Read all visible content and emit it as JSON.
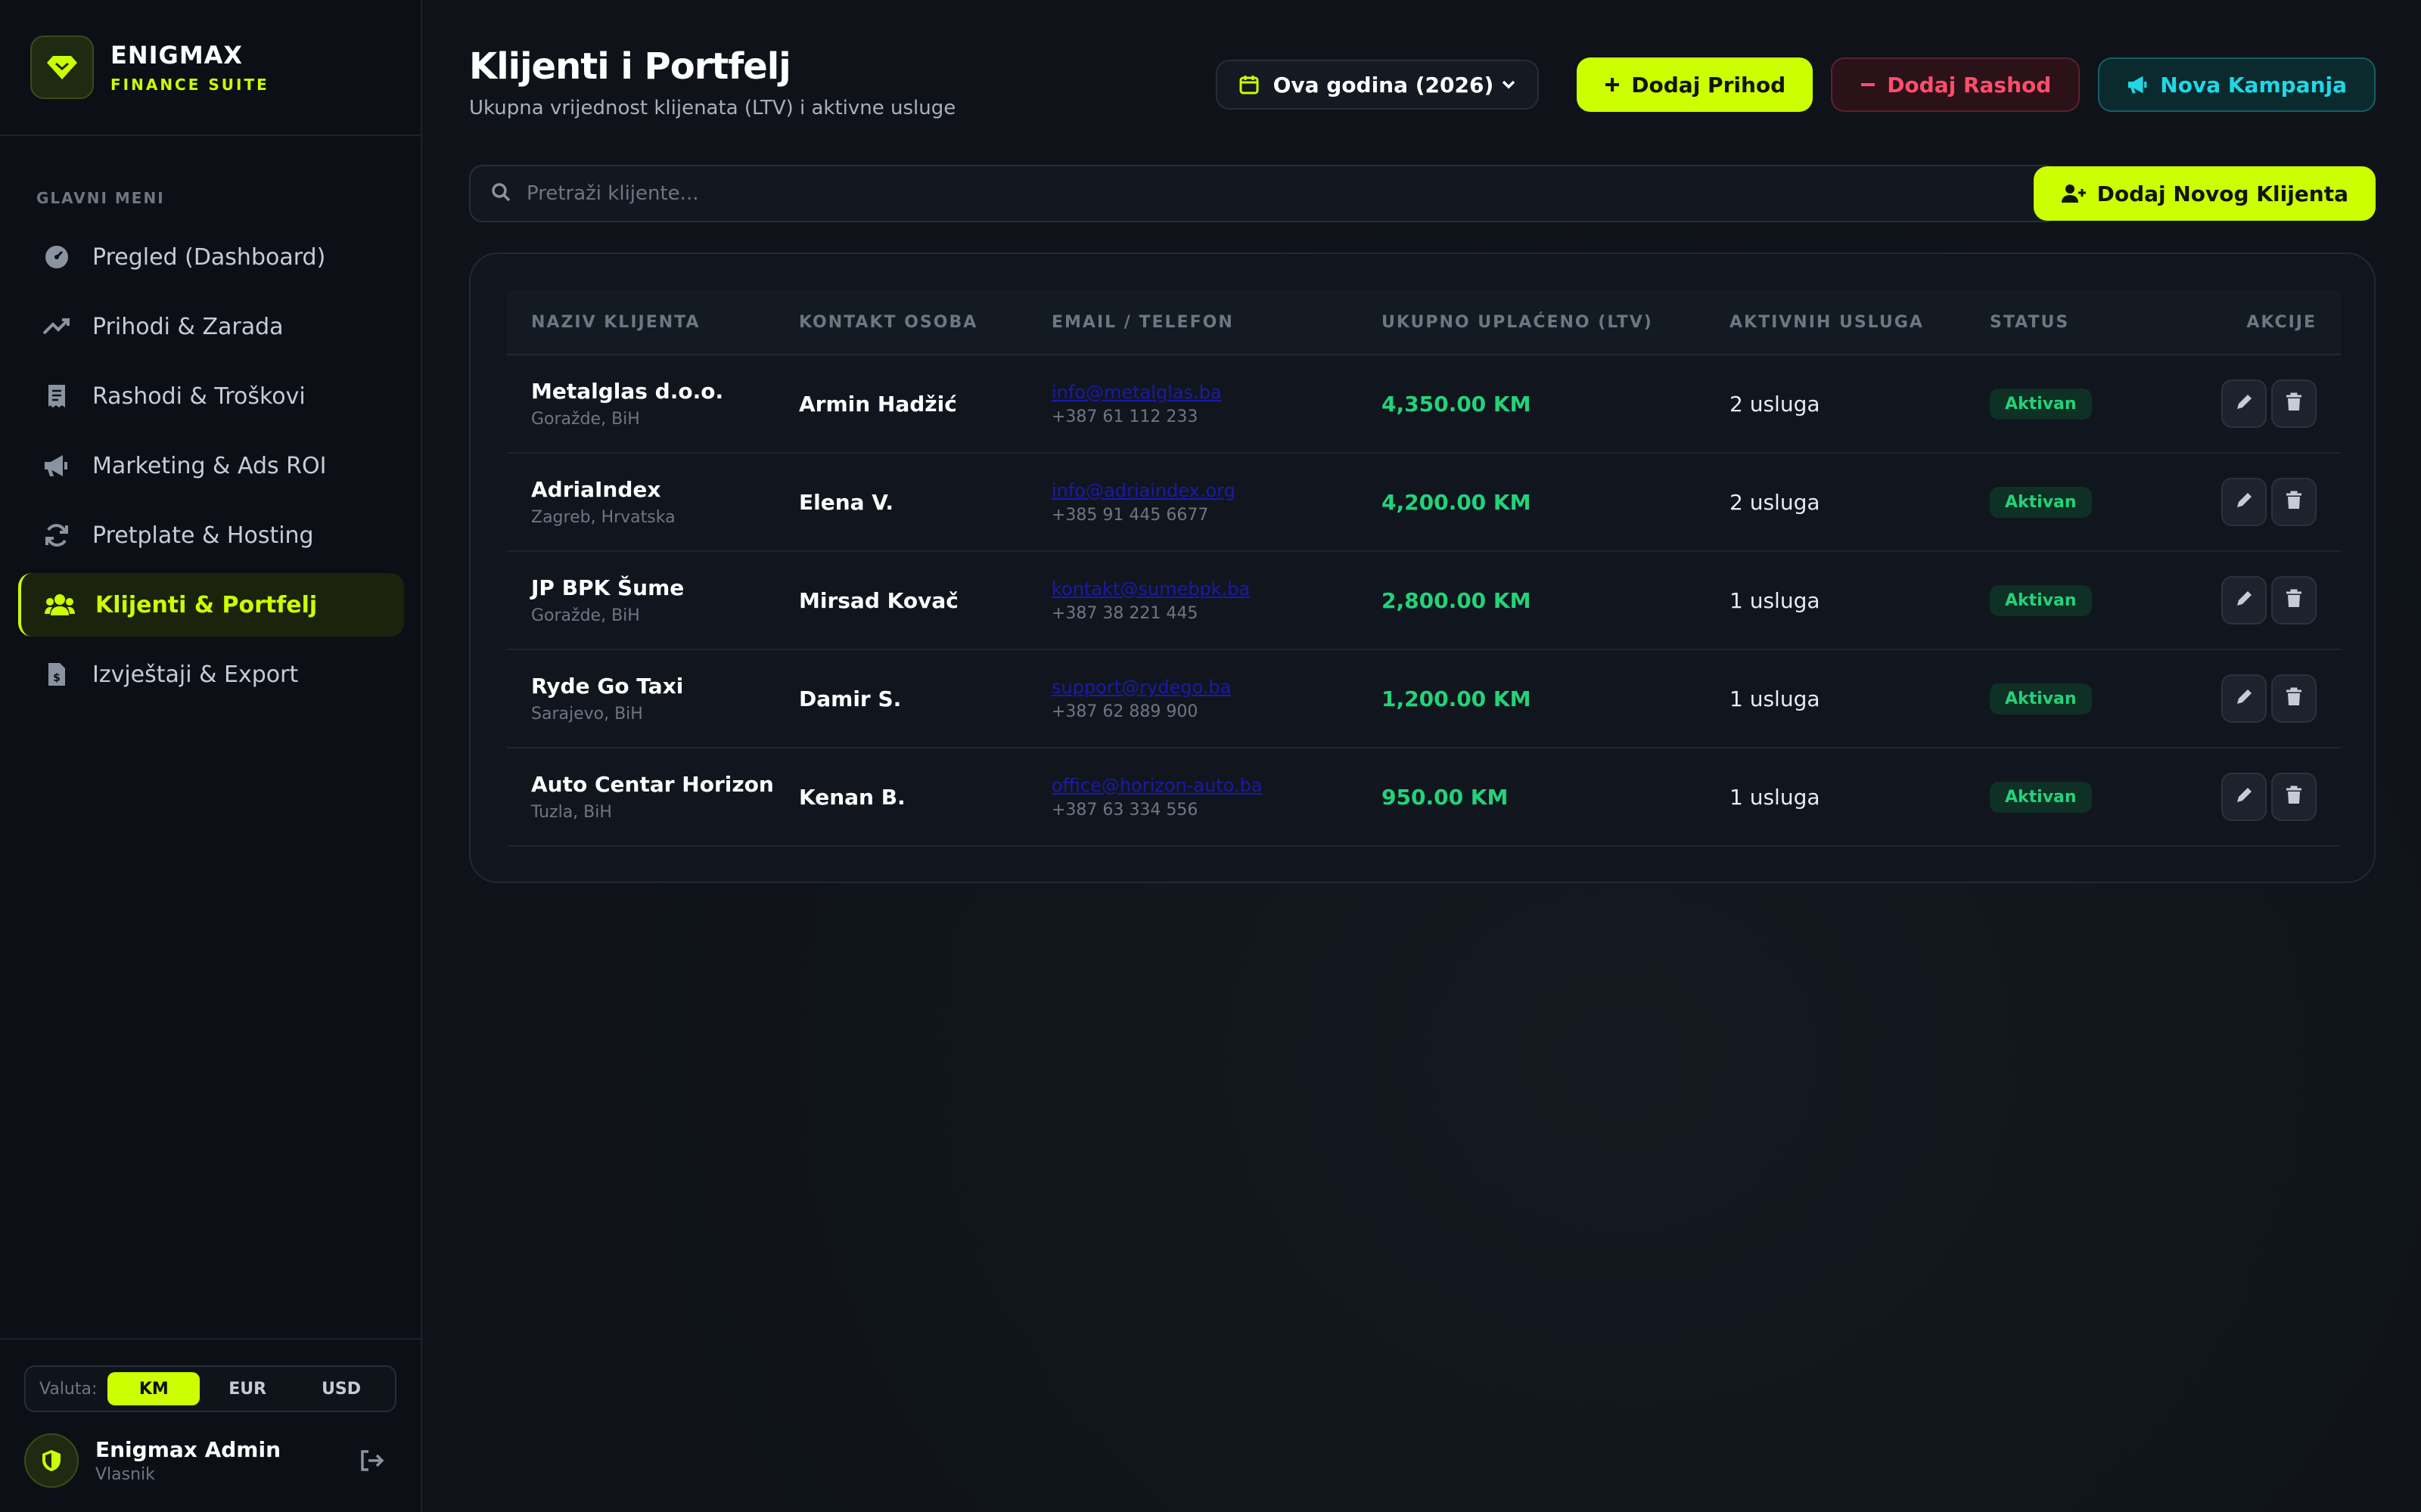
{
  "brand": {
    "name": "ENIGMAX",
    "subtitle": "FINANCE SUITE"
  },
  "menu_heading": "GLAVNI MENI",
  "nav": [
    {
      "label": "Pregled (Dashboard)",
      "icon": "dashboard-gauge-icon"
    },
    {
      "label": "Prihodi & Zarada",
      "icon": "trend-up-icon"
    },
    {
      "label": "Rashodi & Troškovi",
      "icon": "receipt-icon"
    },
    {
      "label": "Marketing & Ads ROI",
      "icon": "megaphone-icon"
    },
    {
      "label": "Pretplate & Hosting",
      "icon": "sync-icon"
    },
    {
      "label": "Klijenti & Portfelj",
      "icon": "users-icon",
      "active": true
    },
    {
      "label": "Izvještaji & Export",
      "icon": "file-invoice-dollar-icon"
    }
  ],
  "currency": {
    "label": "Valuta:",
    "options": [
      "KM",
      "EUR",
      "USD"
    ],
    "selected": "KM"
  },
  "user": {
    "name": "Enigmax Admin",
    "role": "Vlasnik"
  },
  "page": {
    "title": "Klijenti i Portfelj",
    "subtitle": "Ukupna vrijednost klijenata (LTV) i aktivne usluge"
  },
  "toolbar": {
    "period": "Ova godina (2026)",
    "add_income": "Dodaj Prihod",
    "add_expense": "Dodaj Rashod",
    "new_campaign": "Nova Kampanja"
  },
  "search": {
    "placeholder": "Pretraži klijente..."
  },
  "add_client_label": "Dodaj Novog Klijenta",
  "table": {
    "headers": [
      "NAZIV KLIJENTA",
      "KONTAKT OSOBA",
      "EMAIL / TELEFON",
      "UKUPNO UPLAĆENO (LTV)",
      "AKTIVNIH USLUGA",
      "STATUS",
      "AKCIJE"
    ],
    "rows": [
      {
        "name": "Metalglas d.o.o.",
        "location": "Goražde, BiH",
        "contact": "Armin Hadžić",
        "email": "info@metalglas.ba",
        "phone": "+387 61 112 233",
        "ltv": "4,350.00 KM",
        "services": "2 usluga",
        "status": "Aktivan"
      },
      {
        "name": "AdriaIndex",
        "location": "Zagreb, Hrvatska",
        "contact": "Elena V.",
        "email": "info@adriaindex.org",
        "phone": "+385 91 445 6677",
        "ltv": "4,200.00 KM",
        "services": "2 usluga",
        "status": "Aktivan"
      },
      {
        "name": "JP BPK Šume",
        "location": "Goražde, BiH",
        "contact": "Mirsad Kovač",
        "email": "kontakt@sumebpk.ba",
        "phone": "+387 38 221 445",
        "ltv": "2,800.00 KM",
        "services": "1 usluga",
        "status": "Aktivan"
      },
      {
        "name": "Ryde Go Taxi",
        "location": "Sarajevo, BiH",
        "contact": "Damir S.",
        "email": "support@rydego.ba",
        "phone": "+387 62 889 900",
        "ltv": "1,200.00 KM",
        "services": "1 usluga",
        "status": "Aktivan"
      },
      {
        "name": "Auto Centar Horizon",
        "location": "Tuzla, BiH",
        "contact": "Kenan B.",
        "email": "office@horizon-auto.ba",
        "phone": "+387 63 334 556",
        "ltv": "950.00 KM",
        "services": "1 usluga",
        "status": "Aktivan"
      }
    ]
  },
  "colors": {
    "accent": "#ccff00",
    "danger": "#ff4d6a",
    "info": "#1fd8e6",
    "success": "#22d37a",
    "background": "#0f1319"
  }
}
